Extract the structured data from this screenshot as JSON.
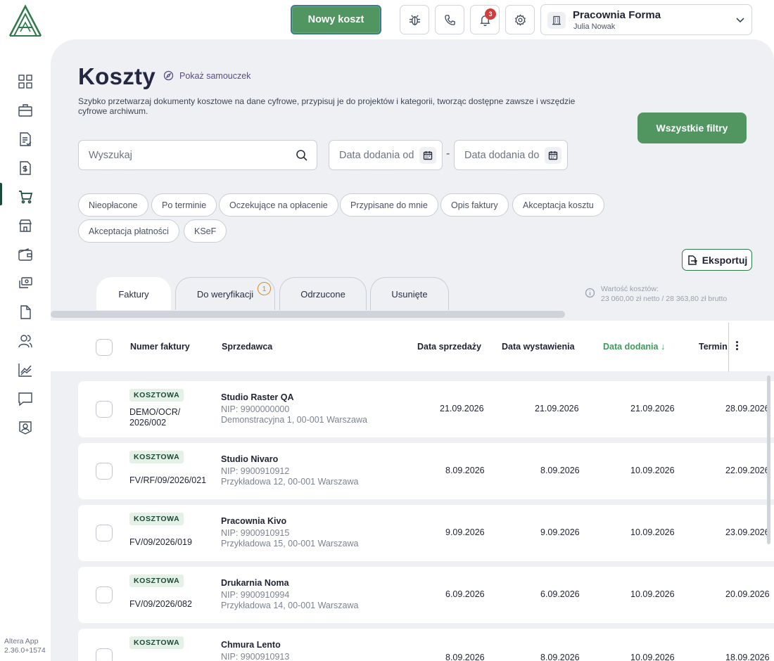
{
  "topbar": {
    "new_cost_label": "Nowy koszt",
    "notifications_count": "3",
    "company_name": "Pracownia Forma",
    "user_name": "Julia Nowak"
  },
  "sidebar": {
    "items": [
      {
        "icon": "dashboard-icon"
      },
      {
        "icon": "briefcase-icon"
      },
      {
        "icon": "invoice-icon"
      },
      {
        "icon": "money-document-icon"
      },
      {
        "icon": "cart-icon",
        "active": true
      },
      {
        "icon": "store-icon"
      },
      {
        "icon": "wallet-icon"
      },
      {
        "icon": "payments-icon"
      },
      {
        "icon": "document-icon"
      },
      {
        "icon": "users-icon"
      },
      {
        "icon": "chart-icon"
      },
      {
        "icon": "chat-icon"
      },
      {
        "icon": "user-badge-icon"
      }
    ],
    "version_line1": "Altera App",
    "version_line2": "2.36.0+1574"
  },
  "page": {
    "title": "Koszty",
    "tutorial_label": "Pokaż samouczek",
    "description": "Szybko przetwarzaj dokumenty kosztowe na dane cyfrowe, przypisuj je do projektów i kategorii, tworząc dostępne zawsze i wszędzie cyfrowe archiwum.",
    "all_filters_label": "Wszystkie filtry",
    "search_placeholder": "Wyszukaj",
    "date_from_placeholder": "Data dodania od",
    "date_to_placeholder": "Data dodania do",
    "date_separator": "-",
    "export_label": "Eksportuj"
  },
  "chips": [
    "Nieopłacone",
    "Po terminie",
    "Oczekujące na opłacenie",
    "Przypisane do mnie",
    "Opis faktury",
    "Akceptacja kosztu",
    "Akceptacja płatności",
    "KSeF"
  ],
  "tabs": [
    {
      "label": "Faktury",
      "active": true
    },
    {
      "label": "Do weryfikacji",
      "badge": "1"
    },
    {
      "label": "Odrzucone"
    },
    {
      "label": "Usunięte"
    }
  ],
  "value_info": {
    "label": "Wartość kosztów:",
    "amount": "23 060,00 zł netto / 28 363,80 zł brutto"
  },
  "table": {
    "columns": {
      "number": "Numer faktury",
      "seller": "Sprzedawca",
      "sale_date": "Data sprzedaży",
      "issue_date": "Data wystawienia",
      "added_date": "Data dodania ↓",
      "due": "Termin"
    },
    "rows": [
      {
        "tag": "KOSZTOWA",
        "number": "DEMO/OCR/ 2026/002",
        "seller": "Studio Raster QA",
        "nip": "NIP: 9900000000",
        "address": "Demonstracyjna 1, 00-001 Warszawa",
        "sale_date": "21.09.2026",
        "issue_date": "21.09.2026",
        "added_date": "21.09.2026",
        "due": "28.09.2026"
      },
      {
        "tag": "KOSZTOWA",
        "number": "FV/RF/09/2026/021",
        "seller": "Studio Nivaro",
        "nip": "NIP: 9900910912",
        "address": "Przykładowa 12, 00-001 Warszawa",
        "sale_date": "8.09.2026",
        "issue_date": "8.09.2026",
        "added_date": "10.09.2026",
        "due": "22.09.2026"
      },
      {
        "tag": "KOSZTOWA",
        "number": "FV/09/2026/019",
        "seller": "Pracownia Kivo",
        "nip": "NIP: 9900910915",
        "address": "Przykładowa 15, 00-001 Warszawa",
        "sale_date": "9.09.2026",
        "issue_date": "9.09.2026",
        "added_date": "10.09.2026",
        "due": "23.09.2026"
      },
      {
        "tag": "KOSZTOWA",
        "number": "FV/09/2026/082",
        "seller": "Drukarnia Noma",
        "nip": "NIP: 9900910994",
        "address": "Przykładowa 14, 00-001 Warszawa",
        "sale_date": "6.09.2026",
        "issue_date": "6.09.2026",
        "added_date": "10.09.2026",
        "due": "20.09.2026"
      },
      {
        "tag": "KOSZTOWA",
        "number": "",
        "seller": "Chmura Lento",
        "nip": "NIP: 9900910913",
        "address": "",
        "sale_date": "8.09.2026",
        "issue_date": "8.09.2026",
        "added_date": "10.09.2026",
        "due": "18.09.2026"
      }
    ]
  }
}
